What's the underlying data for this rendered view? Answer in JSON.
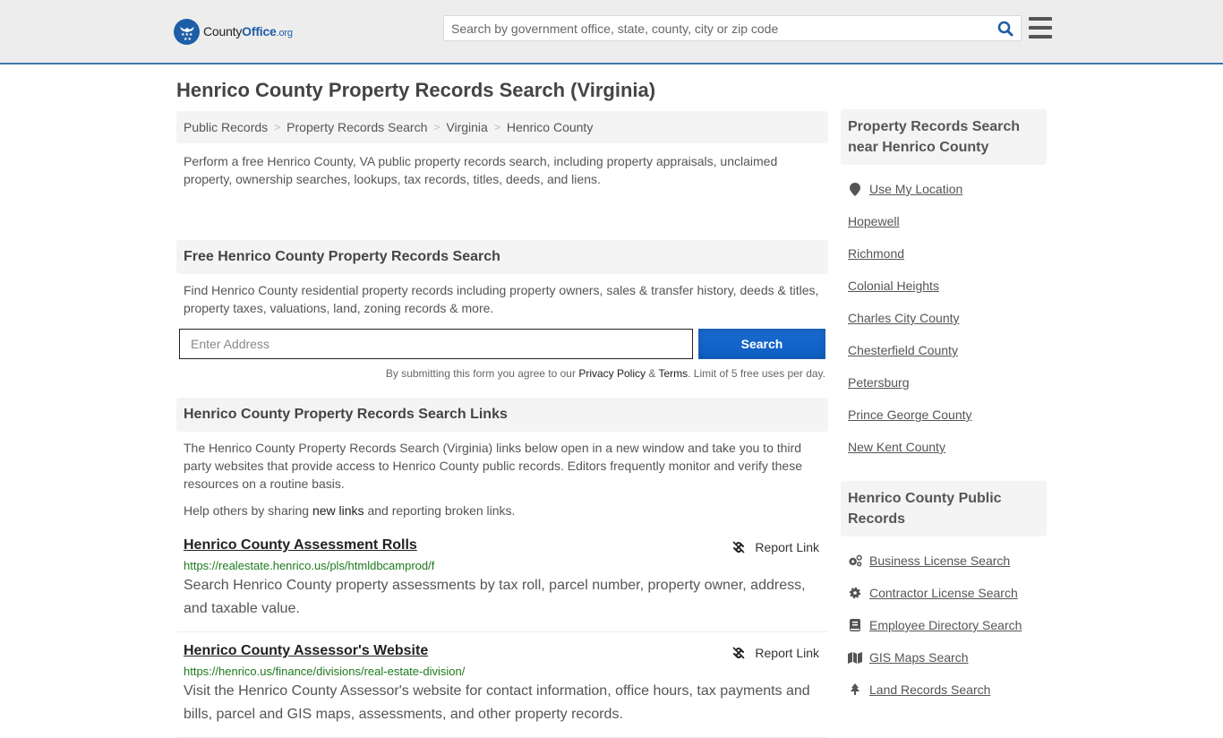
{
  "header": {
    "logo": {
      "name": "County",
      "office": "Office",
      "tld": ".org"
    },
    "search_placeholder": "Search by government office, state, county, city or zip code",
    "colors": {
      "accent": "#1e5ea8",
      "border": "#3a78ab"
    }
  },
  "page_title": "Henrico County Property Records Search (Virginia)",
  "breadcrumb": [
    {
      "label": "Public Records"
    },
    {
      "label": "Property Records Search"
    },
    {
      "label": "Virginia"
    },
    {
      "label": "Henrico County"
    }
  ],
  "intro": "Perform a free Henrico County, VA public property records search, including property appraisals, unclaimed property, ownership searches, lookups, tax records, titles, deeds, and liens.",
  "free_search": {
    "heading": "Free Henrico County Property Records Search",
    "description": "Find Henrico County residential property records including property owners, sales & transfer history, deeds & titles, property taxes, valuations, land, zoning records & more.",
    "address_placeholder": "Enter Address",
    "button_label": "Search",
    "disclaimer_prefix": "By submitting this form you agree to our ",
    "privacy_label": "Privacy Policy",
    "and": " & ",
    "terms_label": "Terms",
    "disclaimer_suffix": ". Limit of 5 free uses per day."
  },
  "links_section": {
    "heading": "Henrico County Property Records Search Links",
    "description": "The Henrico County Property Records Search (Virginia) links below open in a new window and take you to third party websites that provide access to Henrico County public records. Editors frequently monitor and verify these resources on a routine basis.",
    "help_prefix": "Help others by sharing ",
    "help_link": "new links",
    "help_suffix": " and reporting broken links.",
    "report_label": "Report Link",
    "items": [
      {
        "title": "Henrico County Assessment Rolls",
        "url": "https://realestate.henrico.us/pls/htmldbcamprod/f",
        "description": "Search Henrico County property assessments by tax roll, parcel number, property owner, address, and taxable value."
      },
      {
        "title": "Henrico County Assessor's Website",
        "url": "https://henrico.us/finance/divisions/real-estate-division/",
        "description": "Visit the Henrico County Assessor's website for contact information, office hours, tax payments and bills, parcel and GIS maps, assessments, and other property records."
      }
    ]
  },
  "sidebar": {
    "nearby": {
      "heading": "Property Records Search near Henrico County",
      "use_location": "Use My Location",
      "items": [
        "Hopewell",
        "Richmond",
        "Colonial Heights",
        "Charles City County",
        "Chesterfield County",
        "Petersburg",
        "Prince George County",
        "New Kent County"
      ]
    },
    "public_records": {
      "heading": "Henrico County Public Records",
      "items": [
        {
          "label": "Business License Search",
          "icon": "cogs-icon"
        },
        {
          "label": "Contractor License Search",
          "icon": "gear-icon"
        },
        {
          "label": "Employee Directory Search",
          "icon": "book-icon"
        },
        {
          "label": "GIS Maps Search",
          "icon": "map-icon"
        },
        {
          "label": "Land Records Search",
          "icon": "tree-icon"
        }
      ]
    }
  }
}
